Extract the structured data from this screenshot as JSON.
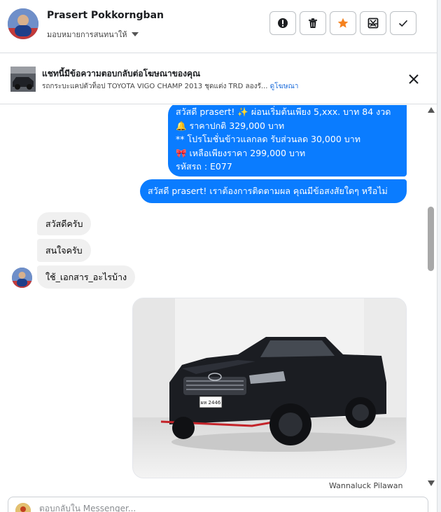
{
  "header": {
    "contact_name": "Prasert Pokkorngban",
    "assign_label": "มอบหมายการสนทนาให้"
  },
  "actions": {
    "icons": [
      "alert-icon",
      "trash-icon",
      "star-icon",
      "spam-icon",
      "check-icon"
    ],
    "accent_color": "#f5821f"
  },
  "ad": {
    "title": "แชทนี้มีข้อความตอบกลับต่อโฆษณาของคุณ",
    "subtitle": "รถกระบะแคปตัวท็อป TOYOTA VIGO CHAMP 2013 ชุดแต่ง TRD ลองรั...",
    "link": "ดูโฆษณา"
  },
  "messages": {
    "out_1": [
      "สวัสดี prasert! ✨  ผ่อนเริ่มต้นเพียง 5,xxx. บาท 84 งวด",
      "🔔 ราคาปกติ 329,000 บาท",
      "** โปรโมชั่นข้าวแลกลด รับส่วนลด 30,000 บาท",
      "🎀  เหลือเพียงราคา 299,000 บาท",
      " รหัสรถ : E077"
    ],
    "out_2": "สวัสดี prasert! เราต้องการติดตามผล คุณมีข้อสงสัยใดๆ หรือไม่",
    "in_1": "สวัสดีครับ",
    "in_2": "สนใจครับ",
    "in_3": "ใช้_เอกสาร_อะไรบ้าง",
    "sender_name": "Wannaluck Pilawan",
    "plate": "ผห 2446"
  },
  "composer": {
    "placeholder": "ตอบกลับใน Messenger..."
  },
  "colors": {
    "bubble_out": "#0a7cff",
    "bubble_in": "#f0f0f0",
    "link": "#216fdb"
  }
}
